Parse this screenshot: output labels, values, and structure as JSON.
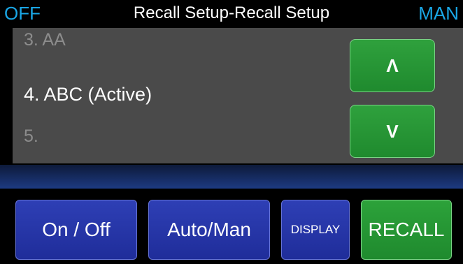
{
  "header": {
    "left_status": "OFF",
    "title": "Recall Setup-Recall Setup",
    "right_status": "MAN",
    "status_color": "#1aa7e6"
  },
  "list": {
    "items": [
      {
        "label": "3. AA",
        "state": "dim"
      },
      {
        "label": "4. ABC (Active)",
        "state": "active"
      },
      {
        "label": "5.",
        "state": "dim"
      }
    ]
  },
  "nav": {
    "up_label": "Λ",
    "down_label": "V"
  },
  "softkeys": {
    "on_off": "On / Off",
    "auto_man": "Auto/Man",
    "display": "DISPLAY",
    "recall": "RECALL"
  },
  "colors": {
    "button_blue": "#2e3fb5",
    "button_green": "#2ca23a",
    "panel_gray": "#4a4a4a",
    "bar_blue": "#1d3a82"
  }
}
